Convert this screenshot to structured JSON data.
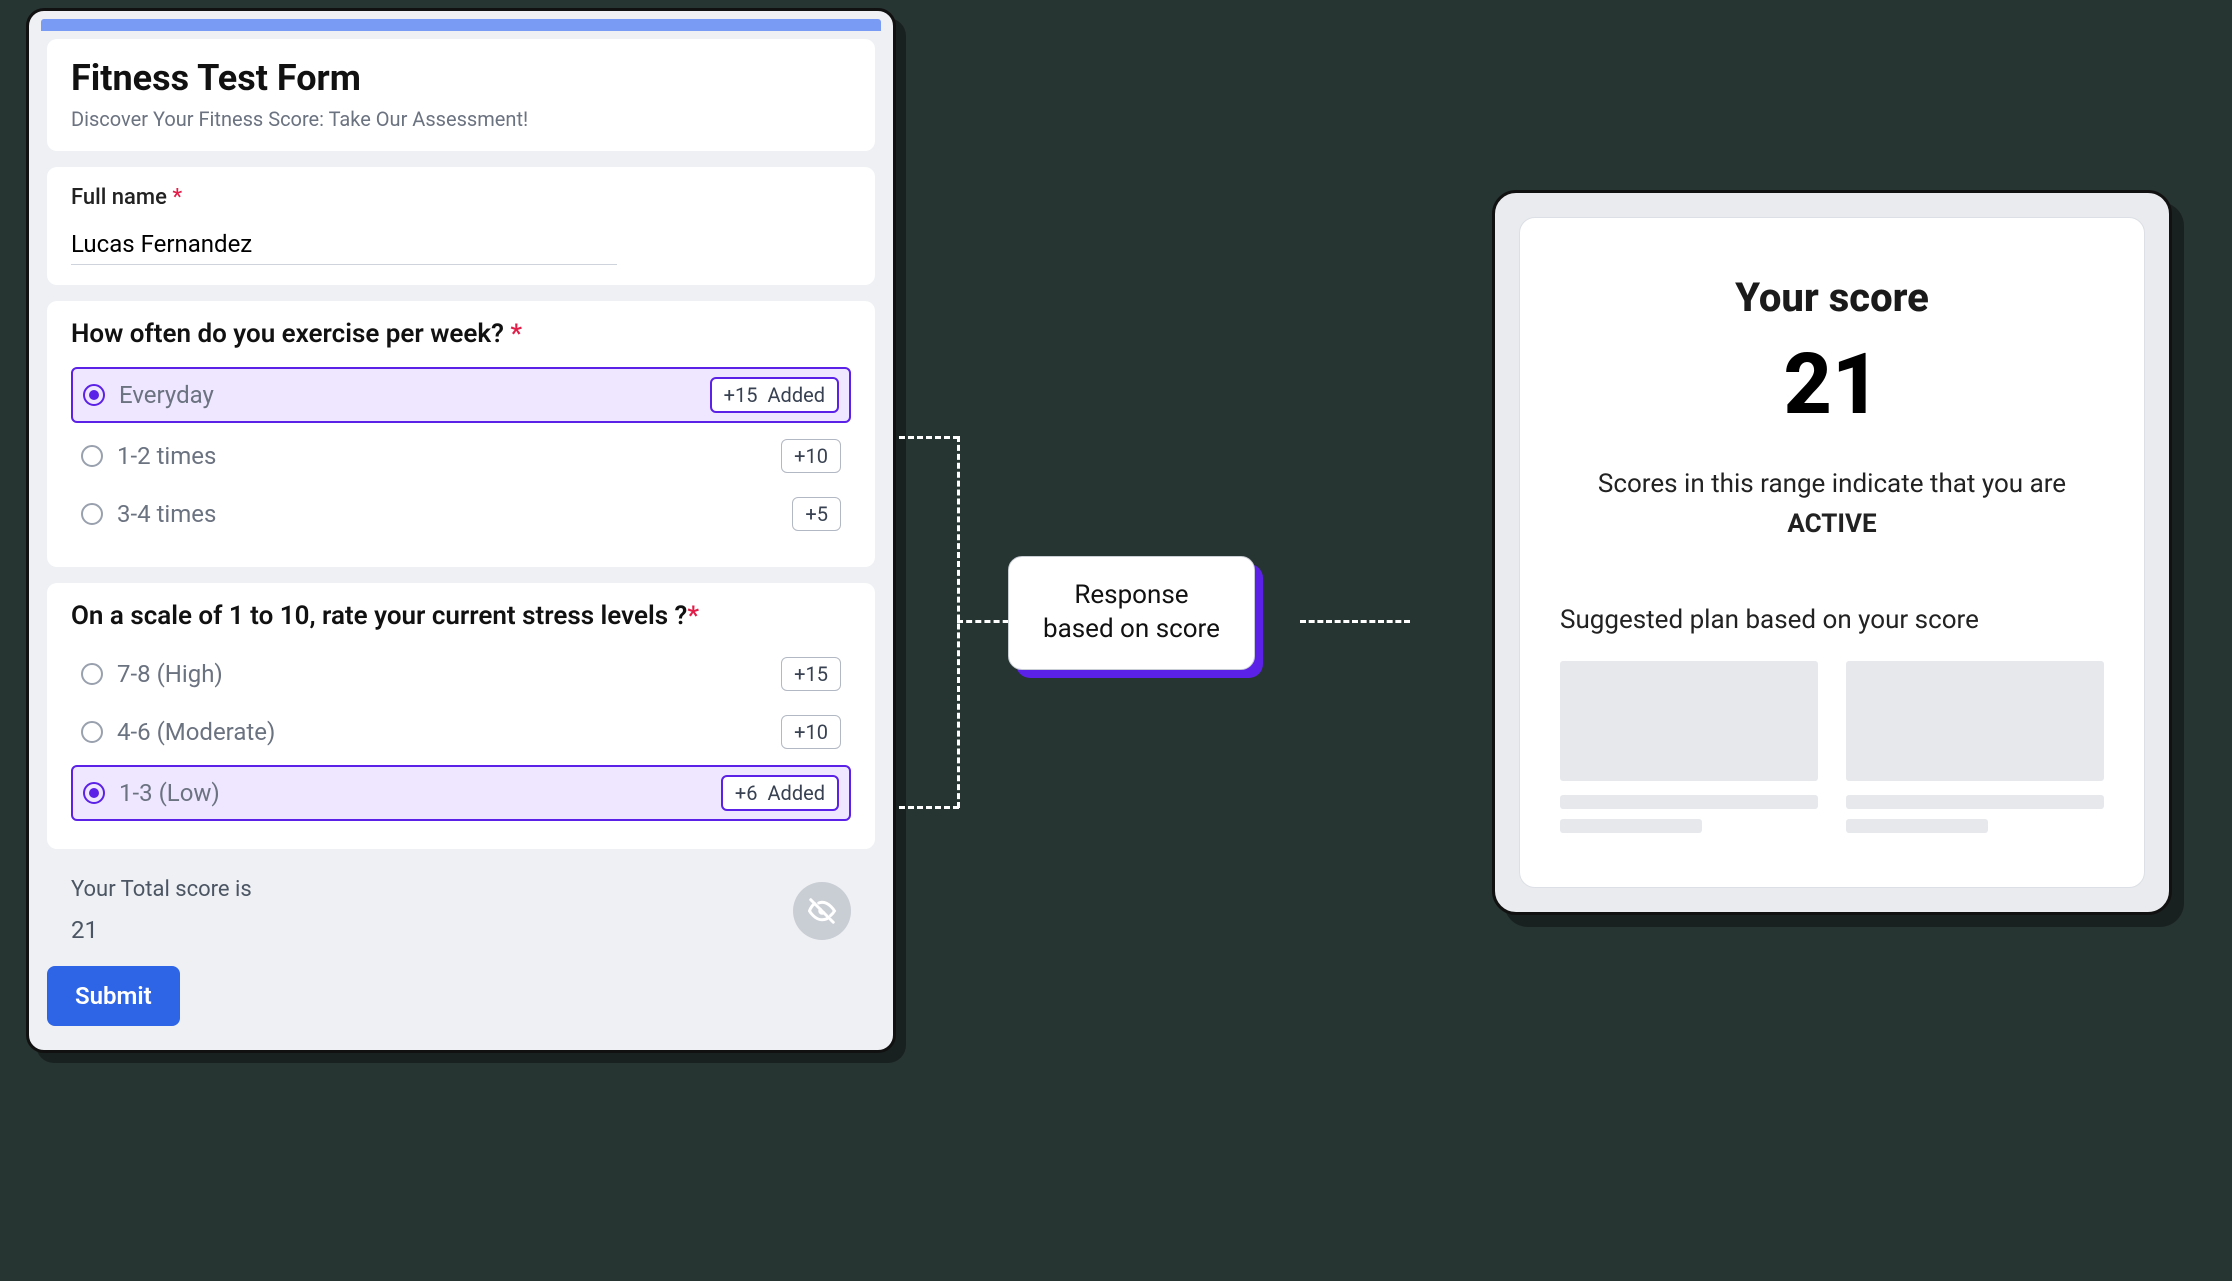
{
  "form": {
    "title": "Fitness Test Form",
    "subtitle": "Discover Your Fitness Score: Take Our Assessment!",
    "name_label": "Full name",
    "name_value": "Lucas Fernandez",
    "q1": {
      "title": "How often do you exercise per week?",
      "options": [
        {
          "label": "Everyday",
          "score": "+15",
          "selected": true
        },
        {
          "label": "1-2 times",
          "score": "+10",
          "selected": false
        },
        {
          "label": "3-4 times",
          "score": "+5",
          "selected": false
        }
      ]
    },
    "q2": {
      "title": "On a scale of 1 to 10, rate your current stress levels ?",
      "options": [
        {
          "label": "7-8 (High)",
          "score": "+15",
          "selected": false
        },
        {
          "label": "4-6 (Moderate)",
          "score": "+10",
          "selected": false
        },
        {
          "label": "1-3 (Low)",
          "score": "+6",
          "selected": true
        }
      ]
    },
    "added_text": "Added",
    "total_label": "Your Total score is",
    "total_value": "21",
    "submit_label": "Submit"
  },
  "callout": {
    "line1": "Response",
    "line2": "based on score"
  },
  "result": {
    "title": "Your score",
    "score": "21",
    "desc_pre": "Scores in this range indicate that you are ",
    "category": "ACTIVE",
    "plan_heading": "Suggested plan based on your score"
  }
}
